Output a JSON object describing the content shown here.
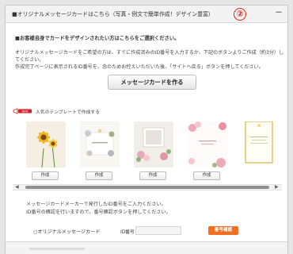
{
  "panel": {
    "title": "■オリジナルメッセージカードはこちら（写真・例文で簡単作成！デザイン豊富）",
    "step_badge": "②",
    "toggle": "－"
  },
  "intro": {
    "heading": "■お客様自身でカードをデザインされたい方はこちらをご選択ください。",
    "line1": "オリジナルメッセージカードをご希望の方は、すでに作成済みのID番号を入力するか、下記のボタンよりご作成（約3分）し",
    "line2": "てください。",
    "line3": "作成完了ページに表示されるID番号を、念のためお控えいただいた後、「サイトへ戻る」ボタンを押してください。",
    "create_button": "メッセージカードを作る"
  },
  "templates": {
    "note": "人気のテンプレートで作成する",
    "note_icon": "megaphone-icon",
    "button_label": "作成",
    "cards": [
      {
        "style": "gerbera"
      },
      {
        "style": "floral-wreath"
      },
      {
        "style": "photo-roses"
      },
      {
        "style": "pink-roses"
      },
      {
        "style": "gold-frame"
      },
      {
        "style": "flower-corner"
      },
      {
        "style": "vertical-green"
      }
    ]
  },
  "maker": {
    "line1": "メッセージカードメーカーで発行したID番号をご入力ください。",
    "line2": "ID番号の確認を行いますので、番号確認ボタンを押してください。",
    "option_label": "○オリジナルメッセージカード",
    "id_label": "ID番号",
    "id_value": "",
    "id_placeholder": "",
    "confirm_button": "番号確認"
  },
  "colors": {
    "accent": "#f26f21",
    "badge": "#e02020"
  }
}
